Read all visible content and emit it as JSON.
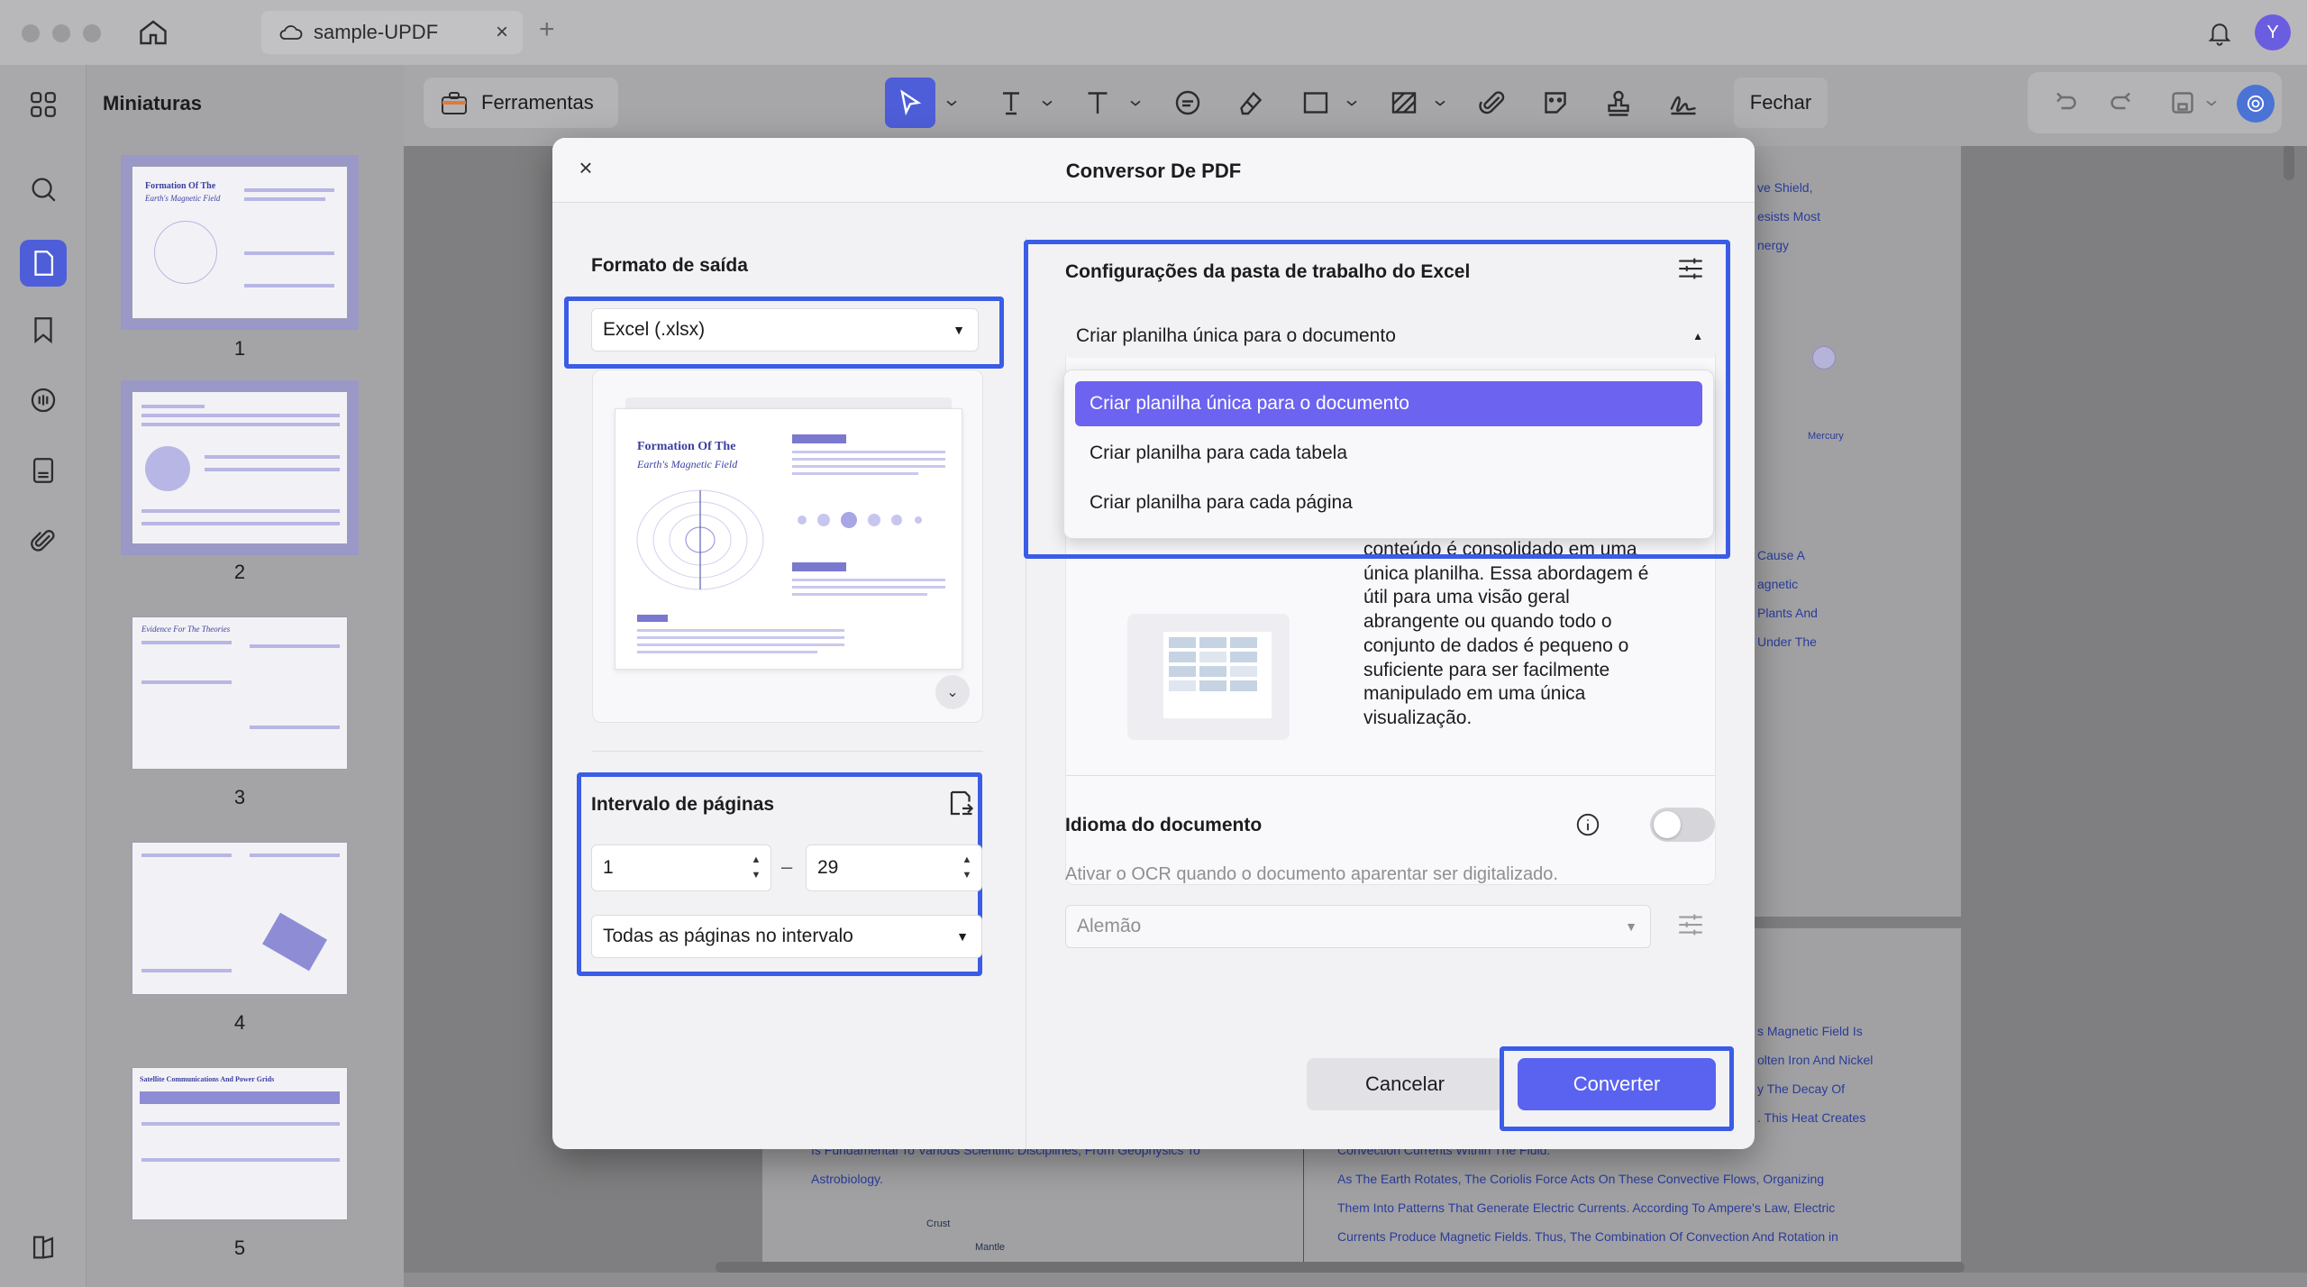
{
  "window": {
    "tab_title": "sample-UPDF",
    "avatar_initial": "Y"
  },
  "sidebar": {
    "title": "Miniaturas",
    "pages": [
      "1",
      "2",
      "3",
      "4",
      "5"
    ],
    "thumb_titles": [
      "Formation Of The",
      "Earth's Magnetic Field",
      "Evidence For The Theories",
      "Satellite Communications And Power Grids"
    ]
  },
  "toolbar": {
    "tools_label": "Ferramentas",
    "close_label": "Fechar"
  },
  "document": {
    "snippets_right_top": [
      "ve Shield,",
      "esists Most",
      "nergy",
      "Mercury",
      "Cause A",
      "agnetic",
      "Plants And",
      "Under The"
    ],
    "snippets_right_bottom": [
      "s Magnetic Field Is",
      "olten Iron And Nickel",
      "y The Decay Of",
      ". This Heat Creates"
    ],
    "bottom_left": [
      "Is Fundamental To Various Scientific Disciplines, From Geophysics To",
      "Astrobiology."
    ],
    "bottom_right": [
      "Convection Currents Within The Fluid.",
      "As The Earth Rotates, The Coriolis Force Acts On These Convective Flows, Organizing",
      "Them Into Patterns That Generate Electric Currents. According To Ampere's Law, Electric",
      "Currents Produce Magnetic Fields. Thus, The Combination Of Convection And Rotation in"
    ],
    "diagram_labels": [
      "Crust",
      "Mantle"
    ]
  },
  "modal": {
    "title": "Conversor De PDF",
    "output_format_label": "Formato de saída",
    "output_format_value": "Excel (.xlsx)",
    "preview_title": "Formation Of The",
    "preview_subtitle": "Earth's Magnetic Field",
    "page_range_label": "Intervalo de páginas",
    "range_from": "1",
    "range_to": "29",
    "range_dash": "–",
    "range_mode": "Todas as páginas no intervalo",
    "excel_settings_label": "Configurações da pasta de trabalho do Excel",
    "sheet_mode_value": "Criar planilha única para o documento",
    "sheet_mode_options": [
      "Criar planilha única para o documento",
      "Criar planilha para cada tabela",
      "Criar planilha para cada página"
    ],
    "description_lines": [
      "conteúdo é consolidado em uma",
      "única planilha. Essa abordagem é",
      "útil para uma visão geral",
      "abrangente ou quando todo o",
      "conjunto de dados é pequeno o",
      "suficiente para ser facilmente",
      "manipulado em uma única",
      "visualização."
    ],
    "doc_language_label": "Idioma do documento",
    "ocr_hint": "Ativar o OCR quando o documento aparentar ser digitalizado.",
    "language_value": "Alemão",
    "cancel_label": "Cancelar",
    "convert_label": "Converter"
  },
  "colors": {
    "accent": "#5a63f0",
    "highlight_border": "#3a5ce6",
    "selected_option": "#6c63f0"
  }
}
